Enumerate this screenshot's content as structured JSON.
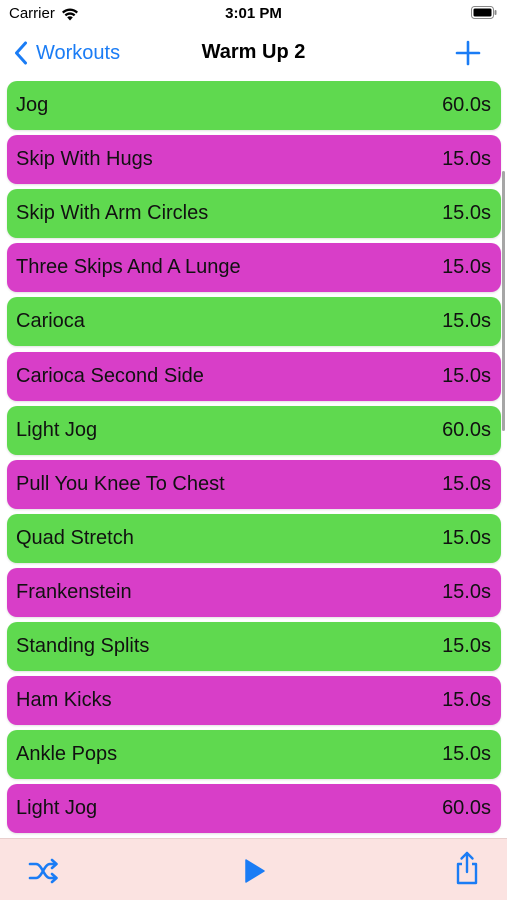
{
  "status_bar": {
    "carrier": "Carrier",
    "time": "3:01 PM"
  },
  "nav": {
    "back_label": "Workouts",
    "title": "Warm Up 2",
    "add_icon": "plus-icon"
  },
  "colors": {
    "accent": "#1a7cf5",
    "green_row": "#5fd94f",
    "magenta_row": "#d83ec8",
    "toolbar_bg": "#fbe3e1"
  },
  "exercises": [
    {
      "name": "Jog",
      "duration": "60.0s",
      "color": "green"
    },
    {
      "name": "Skip With Hugs",
      "duration": "15.0s",
      "color": "magenta"
    },
    {
      "name": "Skip With Arm Circles",
      "duration": "15.0s",
      "color": "green"
    },
    {
      "name": "Three Skips And A Lunge",
      "duration": "15.0s",
      "color": "magenta"
    },
    {
      "name": "Carioca",
      "duration": "15.0s",
      "color": "green"
    },
    {
      "name": "Carioca Second Side",
      "duration": "15.0s",
      "color": "magenta"
    },
    {
      "name": "Light Jog",
      "duration": "60.0s",
      "color": "green"
    },
    {
      "name": "Pull You Knee To Chest",
      "duration": "15.0s",
      "color": "magenta"
    },
    {
      "name": "Quad Stretch",
      "duration": "15.0s",
      "color": "green"
    },
    {
      "name": "Frankenstein",
      "duration": "15.0s",
      "color": "magenta"
    },
    {
      "name": "Standing Splits",
      "duration": "15.0s",
      "color": "green"
    },
    {
      "name": "Ham Kicks",
      "duration": "15.0s",
      "color": "magenta"
    },
    {
      "name": "Ankle Pops",
      "duration": "15.0s",
      "color": "green"
    },
    {
      "name": "Light Jog",
      "duration": "60.0s",
      "color": "magenta"
    }
  ],
  "toolbar": {
    "shuffle_icon": "shuffle-icon",
    "play_icon": "play-icon",
    "share_icon": "share-icon"
  }
}
